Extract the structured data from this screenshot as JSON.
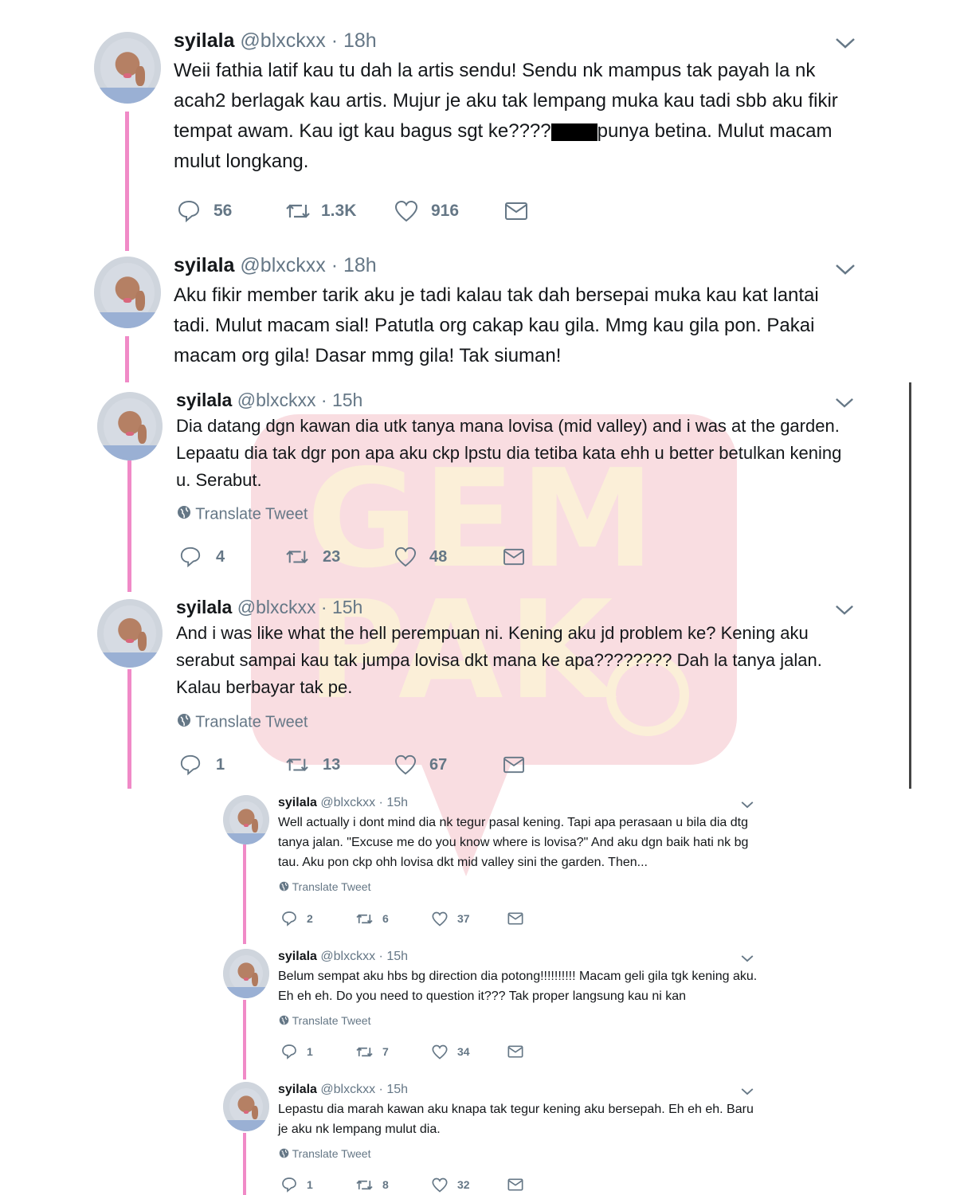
{
  "user": {
    "name": "syilala",
    "handle": "@blxckxx",
    "dot": "·"
  },
  "translate_label": "Translate Tweet",
  "watermark": {
    "text": "GEMPAK",
    "color": "#f6c9cf"
  },
  "colors": {
    "thread_line": "#f08ac7",
    "muted": "#657786",
    "text": "#14171a"
  },
  "tweets": [
    {
      "time": "18h",
      "text_before_redaction": "Weii fathia latif kau tu dah la artis sendu! Sendu nk mampus tak payah la nk acah2 berlagak kau artis. Mujur je aku tak lempang muka kau tadi sbb aku fikir tempat awam. Kau igt kau bagus sgt ke????",
      "text_after_redaction": "punya betina. Mulut macam mulut longkang.",
      "replies": "56",
      "retweets": "1.3K",
      "likes": "916"
    },
    {
      "time": "18h",
      "text": "Aku fikir member tarik aku je tadi kalau tak dah bersepai muka kau kat lantai tadi. Mulut macam sial! Patutla org cakap kau gila. Mmg kau gila pon. Pakai macam org gila! Dasar mmg gila! Tak siuman!"
    },
    {
      "time": "15h",
      "text": "Dia datang dgn kawan dia utk tanya mana lovisa (mid valley) and i was at the garden. Lepaatu dia tak dgr pon apa aku ckp lpstu dia tetiba kata ehh u better betulkan kening u. Serabut.",
      "replies": "4",
      "retweets": "23",
      "likes": "48"
    },
    {
      "time": "15h",
      "text": "And i was like what the hell perempuan ni. Kening aku jd problem ke? Kening aku serabut sampai kau tak jumpa lovisa dkt mana ke apa???????? Dah la tanya jalan. Kalau berbayar tak pe.",
      "replies": "1",
      "retweets": "13",
      "likes": "67"
    },
    {
      "time": "15h",
      "text": "Well actually i dont mind dia nk tegur pasal kening. Tapi apa perasaan u bila dia dtg tanya jalan. \"Excuse me do you know where is lovisa?\" And aku dgn baik hati nk bg tau. Aku pon ckp ohh lovisa dkt mid valley sini the garden. Then...",
      "replies": "2",
      "retweets": "6",
      "likes": "37"
    },
    {
      "time": "15h",
      "text": "Belum sempat aku hbs bg direction dia potong!!!!!!!!!! Macam geli gila tgk kening aku. Eh eh eh. Do you need to question it??? Tak proper langsung kau ni kan",
      "replies": "1",
      "retweets": "7",
      "likes": "34"
    },
    {
      "time": "15h",
      "text": "Lepastu dia marah kawan aku knapa tak tegur kening aku bersepah. Eh eh eh. Baru je aku nk lempang mulut dia.",
      "replies": "1",
      "retweets": "8",
      "likes": "32"
    }
  ]
}
